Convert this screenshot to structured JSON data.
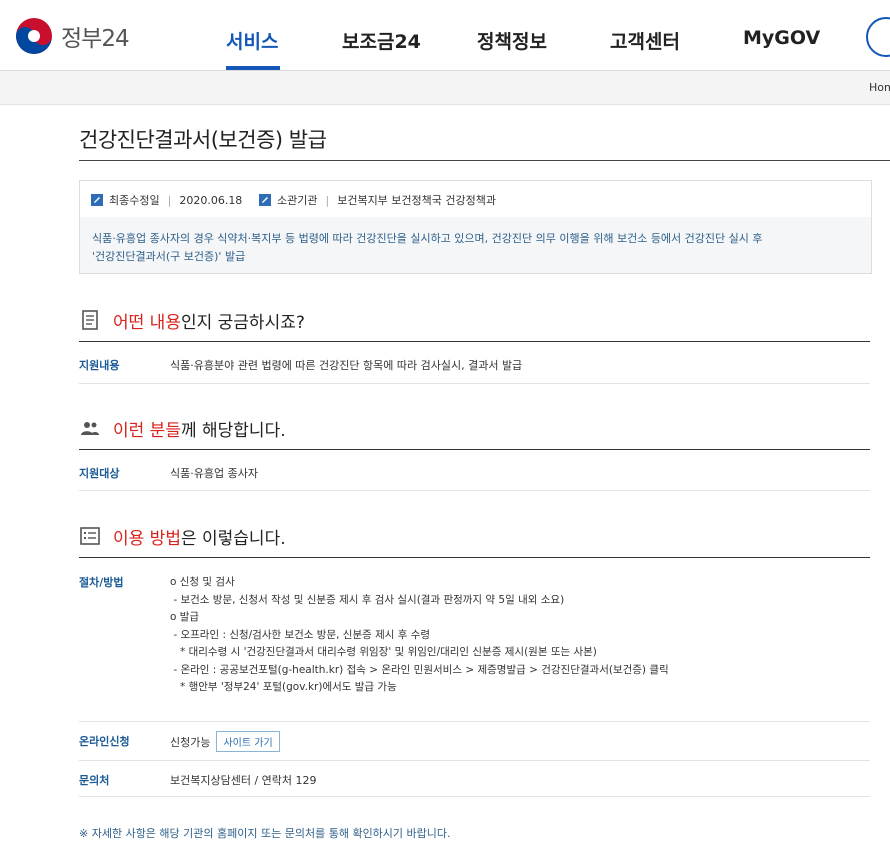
{
  "header": {
    "logo_text": "정부24",
    "nav": [
      {
        "label": "서비스",
        "active": true
      },
      {
        "label": "보조금24"
      },
      {
        "label": "정책정보"
      },
      {
        "label": "고객센터"
      },
      {
        "label": "MyGOV"
      }
    ],
    "accent_color": "#1357b8"
  },
  "breadcrumb": {
    "home": "Home"
  },
  "page": {
    "title": "건강진단결과서(보건증) 발급",
    "meta": {
      "updated_label": "최종수정일",
      "updated_value": "2020.06.18",
      "agency_label": "소관기관",
      "agency_value": "보건복지부 보건정책국 건강정책과"
    },
    "summary_line1": "식품·유흥업 종사자의 경우 식약처·복지부 등 법령에 따라 건강진단을 실시하고 있으며, 건강진단 의무 이행을 위해 보건소 등에서 건강진단 실시 후",
    "summary_line2": "'건강진단결과서(구 보건증)' 발급"
  },
  "sections": {
    "content": {
      "title_red": "어떤 내용",
      "title_rest": "인지 궁금하시죠?",
      "label": "지원내용",
      "value": "식품·유흥분야 관련 법령에 따른 건강진단 항목에 따라 검사실시, 결과서 발급"
    },
    "target": {
      "title_red": "이런 분들",
      "title_rest": "께 해당합니다.",
      "label": "지원대상",
      "value": "식품·유흥업 종사자"
    },
    "method": {
      "title_red": "이용 방법",
      "title_rest": "은 이렇습니다.",
      "procedure_label": "절차/방법",
      "procedure_lines": [
        "o 신청 및 검사",
        " - 보건소 방문, 신청서 작성 및 신분증 제시 후 검사 실시(결과 판정까지 약 5일 내외 소요)",
        "",
        "o 발급",
        " - 오프라인 : 신청/검사한 보건소 방문, 신분증 제시 후 수령",
        "   * 대리수령 시 '건강진단결과서 대리수령 위임장' 및 위임인/대리인 신분증 제시(원본 또는 사본)",
        " - 온라인 : 공공보건포털(g-health.kr) 접속 > 온라인 민원서비스 > 제증명발급 > 건강진단결과서(보건증) 클릭",
        "   * 행안부 '정부24' 포털(gov.kr)에서도 발급 가능"
      ],
      "online_label": "온라인신청",
      "online_value": "신청가능",
      "site_button": "사이트 가기",
      "contact_label": "문의처",
      "contact_value": "보건복지상담센터 / 연락처 129"
    }
  },
  "footnote": "※ 자세한 사항은 해당 기관의 홈페이지 또는 문의처를 통해 확인하시기 바랍니다."
}
